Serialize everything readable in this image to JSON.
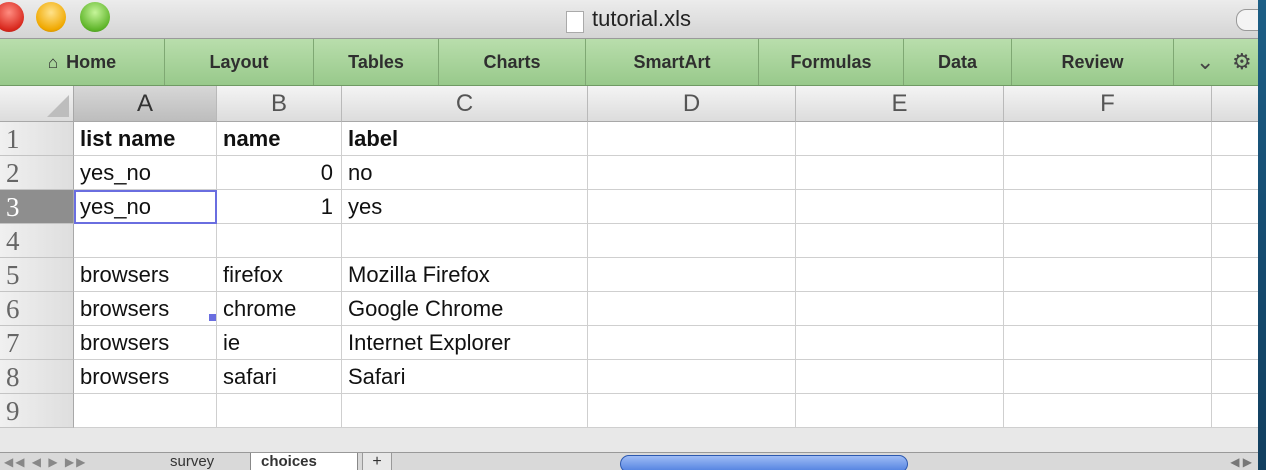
{
  "window": {
    "title": "tutorial.xls"
  },
  "ribbon": {
    "tabs": [
      "Home",
      "Layout",
      "Tables",
      "Charts",
      "SmartArt",
      "Formulas",
      "Data",
      "Review"
    ],
    "home_icon": "house-icon",
    "overflow_icon": "chevron-down-icon",
    "settings_icon": "gear-icon"
  },
  "sheet": {
    "columns": [
      "A",
      "B",
      "C",
      "D",
      "E",
      "F"
    ],
    "rows": [
      {
        "num": "1",
        "cells": [
          "list name",
          "name",
          "label"
        ]
      },
      {
        "num": "2",
        "cells": [
          "yes_no",
          "0",
          "no"
        ]
      },
      {
        "num": "3",
        "cells": [
          "yes_no",
          "1",
          "yes"
        ]
      },
      {
        "num": "4",
        "cells": [
          "",
          "",
          ""
        ]
      },
      {
        "num": "5",
        "cells": [
          "browsers",
          "firefox",
          "Mozilla Firefox"
        ]
      },
      {
        "num": "6",
        "cells": [
          "browsers",
          "chrome",
          "Google Chrome"
        ]
      },
      {
        "num": "7",
        "cells": [
          "browsers",
          "ie",
          "Internet Explorer"
        ]
      },
      {
        "num": "8",
        "cells": [
          "browsers",
          "safari",
          "Safari"
        ]
      },
      {
        "num": "9",
        "cells": [
          "",
          "",
          ""
        ]
      }
    ],
    "selected_cell": "A3"
  },
  "sheet_tabs": {
    "tabs": [
      "survey",
      "choices"
    ],
    "active": "choices",
    "add_label": "+"
  },
  "colors": {
    "ribbon": "#a9d49c",
    "selection": "#6a6ee0",
    "desktop": "#1d5f86"
  }
}
